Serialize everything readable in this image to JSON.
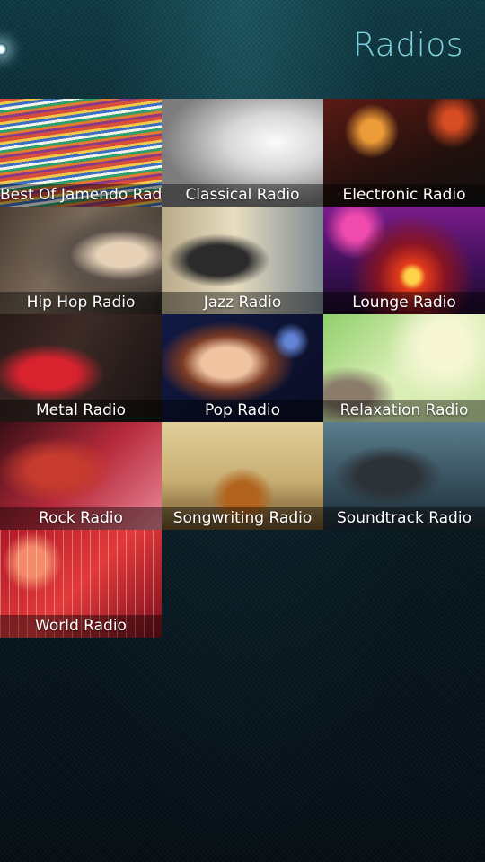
{
  "header": {
    "title": "Radios"
  },
  "radios": [
    {
      "label": "Best Of Jamendo Radio",
      "art": "art-vinyl"
    },
    {
      "label": "Classical Radio",
      "art": "art-classical"
    },
    {
      "label": "Electronic Radio",
      "art": "art-electronic"
    },
    {
      "label": "Hip Hop Radio",
      "art": "art-hiphop"
    },
    {
      "label": "Jazz Radio",
      "art": "art-jazz"
    },
    {
      "label": "Lounge Radio",
      "art": "art-lounge"
    },
    {
      "label": "Metal Radio",
      "art": "art-metal"
    },
    {
      "label": "Pop Radio",
      "art": "art-pop"
    },
    {
      "label": "Relaxation Radio",
      "art": "art-relax"
    },
    {
      "label": "Rock Radio",
      "art": "art-rock"
    },
    {
      "label": "Songwriting Radio",
      "art": "art-songwriting"
    },
    {
      "label": "Soundtrack Radio",
      "art": "art-soundtrack"
    },
    {
      "label": "World Radio",
      "art": "art-world"
    }
  ]
}
